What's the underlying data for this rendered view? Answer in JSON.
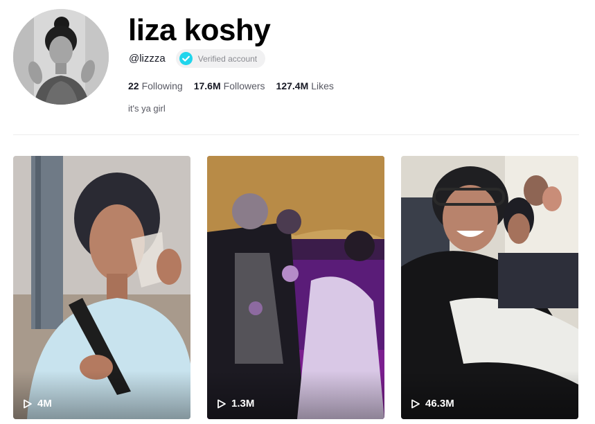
{
  "profile": {
    "display_name": "liza koshy",
    "handle": "@lizzza",
    "verified_label": "Verified account",
    "bio": "it's ya girl",
    "avatar_icon": "avatar-photo-icon",
    "verified_color": "#20d5ec"
  },
  "stats": [
    {
      "value": "22",
      "label": "Following"
    },
    {
      "value": "17.6M",
      "label": "Followers"
    },
    {
      "value": "127.4M",
      "label": "Likes"
    }
  ],
  "videos": [
    {
      "views": "4M",
      "icon": "play-icon"
    },
    {
      "views": "1.3M",
      "icon": "play-icon"
    },
    {
      "views": "46.3M",
      "icon": "play-icon"
    }
  ]
}
